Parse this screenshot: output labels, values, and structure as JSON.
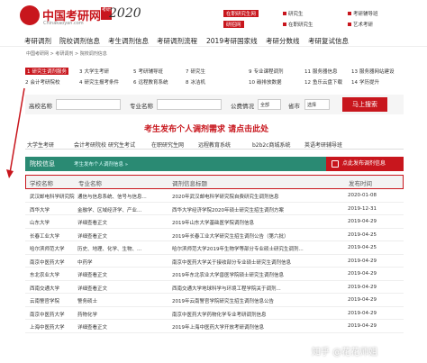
{
  "header": {
    "logo_cn": "中国考研网",
    "logo_en": "Chinakaoyan.com",
    "logo_badge": "考研",
    "year": "2020",
    "top_links": [
      "在职研究生网",
      "研究生",
      "考研辅导班",
      "研招网",
      "在职研究生",
      "艺术考研"
    ]
  },
  "nav": [
    "考研调剂",
    "院校调剂信息",
    "考生调剂信息",
    "考研调剂流程",
    "2019考研国家线",
    "考研分数线",
    "考研复试信息"
  ],
  "breadcrumb": "中国考研网 > 考研调剂 > 院校调剂信息",
  "links": {
    "row1": [
      {
        "n": "1",
        "t": "研究生调剂服务",
        "hl": true
      },
      {
        "n": "3",
        "t": "大学生考研"
      },
      {
        "n": "5",
        "t": "考研辅导班"
      },
      {
        "n": "7",
        "t": "研究生"
      },
      {
        "n": "9",
        "t": "专业课程调剂"
      },
      {
        "n": "11",
        "t": "服务器信息"
      },
      {
        "n": "13",
        "t": "服务器网站建设"
      }
    ],
    "row2": [
      {
        "n": "2",
        "t": "会计考研院校"
      },
      {
        "n": "4",
        "t": "研究生报考条件"
      },
      {
        "n": "6",
        "t": "远程教育系统"
      },
      {
        "n": "8",
        "t": "冰洁机"
      },
      {
        "n": "10",
        "t": "碳排放数据"
      },
      {
        "n": "12",
        "t": "鱼乐云盘下载"
      },
      {
        "n": "14",
        "t": "学历提升"
      }
    ]
  },
  "search": {
    "school_label": "高校名称",
    "major_label": "专业名称",
    "status_label": "公费情况",
    "status_value": "全部",
    "province_label": "省市",
    "province_value": "选择",
    "button": "马上搜索"
  },
  "promo": "考生发布个人调剂需求   请点击此处",
  "tabs": [
    "大学生考研",
    "会计考研院校",
    "研究生考试",
    "在职研究生网",
    "远程教育系统",
    "b2b2c商城系统",
    "英语考研辅导班"
  ],
  "bar": {
    "title": "院校信息",
    "subtitle": "考生发布个人调剂信息 »",
    "cta": "点此发布调剂信息"
  },
  "table": {
    "headers": [
      "学校名称",
      "专业名称",
      "调剂信息标题",
      "发布时间"
    ],
    "rows": [
      [
        "武汉邮电科学研究院",
        "通信与信息系统、信号与信息...",
        "2020年武汉邮电科学研究院自费研究生调剂信息",
        "2020-01-08"
      ],
      [
        "西华大学",
        "金融学、区域经济学、产业...",
        "西华大学经济学院2020年硕士研究生招生调剂方案",
        "2019-12-31"
      ],
      [
        "山东大学",
        "详细查看正文",
        "2019年山东大学基础医学院调剂信息",
        "2019-04-29"
      ],
      [
        "长春工业大学",
        "详细查看正文",
        "2019年长春工业大学研究生招生调剂公告（第六批）",
        "2019-04-25"
      ],
      [
        "哈尔滨师范大学",
        "历史、地理、化学、生物、...",
        "哈尔滨师范大学2019年生物学等部分专业硕士研究生调剂...",
        "2019-04-25"
      ],
      [
        "南京中医药大学",
        "中药学",
        "南京中医药大学关于接收部分专业硕士研究生调剂信息",
        "2019-04-29"
      ],
      [
        "东北农业大学",
        "详细查看正文",
        "2019年东北农业大学兽医学院硕士研究生调剂信息",
        "2019-04-29"
      ],
      [
        "西南交通大学",
        "详细查看正文",
        "西南交通大学地球科学与环境工程学院关于调剂...",
        "2019-04-29"
      ],
      [
        "云南警官学院",
        "警务硕士",
        "2019年云南警官学院研究生招生调剂信息公告",
        "2019-04-29"
      ],
      [
        "南京中医药大学",
        "药物化学",
        "南京中医药大学药物化学专业考研调剂信息",
        "2019-04-29"
      ],
      [
        "上海中医药大学",
        "详细查看正文",
        "2019年上海中医药大学开放考研调剂信息",
        "2019-04-29"
      ]
    ]
  },
  "watermark": "知乎 @花花师姐"
}
